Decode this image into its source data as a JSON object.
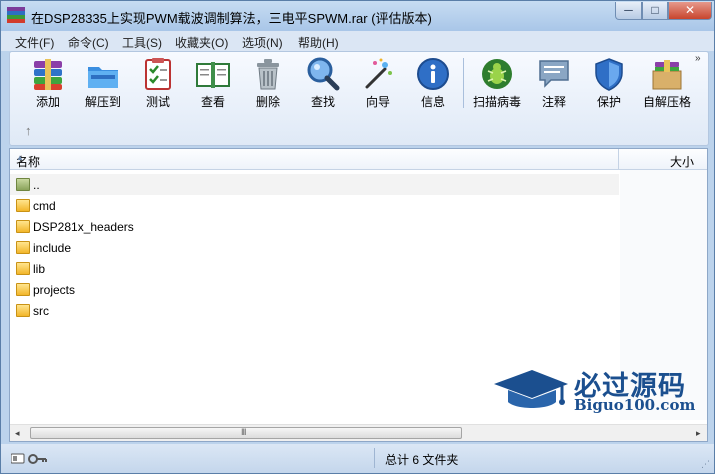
{
  "window": {
    "title": "在DSP28335上实现PWM载波调制算法，三电平SPWM.rar (评估版本)",
    "controls": {
      "minimize": "─",
      "maximize": "□",
      "close": "✕"
    }
  },
  "menu": [
    "文件(F)",
    "命令(C)",
    "工具(S)",
    "收藏夹(O)",
    "选项(N)",
    "帮助(H)"
  ],
  "toolbar": {
    "buttons": [
      {
        "label": "添加",
        "icon": "add-archive-icon"
      },
      {
        "label": "解压到",
        "icon": "extract-to-icon"
      },
      {
        "label": "测试",
        "icon": "test-icon"
      },
      {
        "label": "查看",
        "icon": "view-icon"
      },
      {
        "label": "删除",
        "icon": "delete-icon"
      },
      {
        "label": "查找",
        "icon": "find-icon"
      },
      {
        "label": "向导",
        "icon": "wizard-icon"
      },
      {
        "label": "信息",
        "icon": "info-icon"
      },
      {
        "label": "扫描病毒",
        "icon": "virus-scan-icon"
      },
      {
        "label": "注释",
        "icon": "comment-icon"
      },
      {
        "label": "保护",
        "icon": "protect-icon"
      },
      {
        "label": "自解压格",
        "icon": "sfx-icon"
      }
    ],
    "more": "»",
    "up": "↑"
  },
  "columns": {
    "name": "名称",
    "size": "大小",
    "sort_caret": "▲"
  },
  "files": [
    {
      "name": "..",
      "type": "parent"
    },
    {
      "name": "cmd",
      "type": "folder"
    },
    {
      "name": "DSP281x_headers",
      "type": "folder"
    },
    {
      "name": "include",
      "type": "folder"
    },
    {
      "name": "lib",
      "type": "folder"
    },
    {
      "name": "projects",
      "type": "folder"
    },
    {
      "name": "src",
      "type": "folder"
    }
  ],
  "scrollbar": {
    "left": "◂",
    "right": "▸",
    "grip": "III"
  },
  "watermark": {
    "cn": "必过源码",
    "en": "Biguo100.com"
  },
  "status": {
    "summary": "总计 6 文件夹",
    "resize": "⋰"
  },
  "colors": {
    "accent": "#1b4f8f",
    "folder": "#f2b62a"
  }
}
